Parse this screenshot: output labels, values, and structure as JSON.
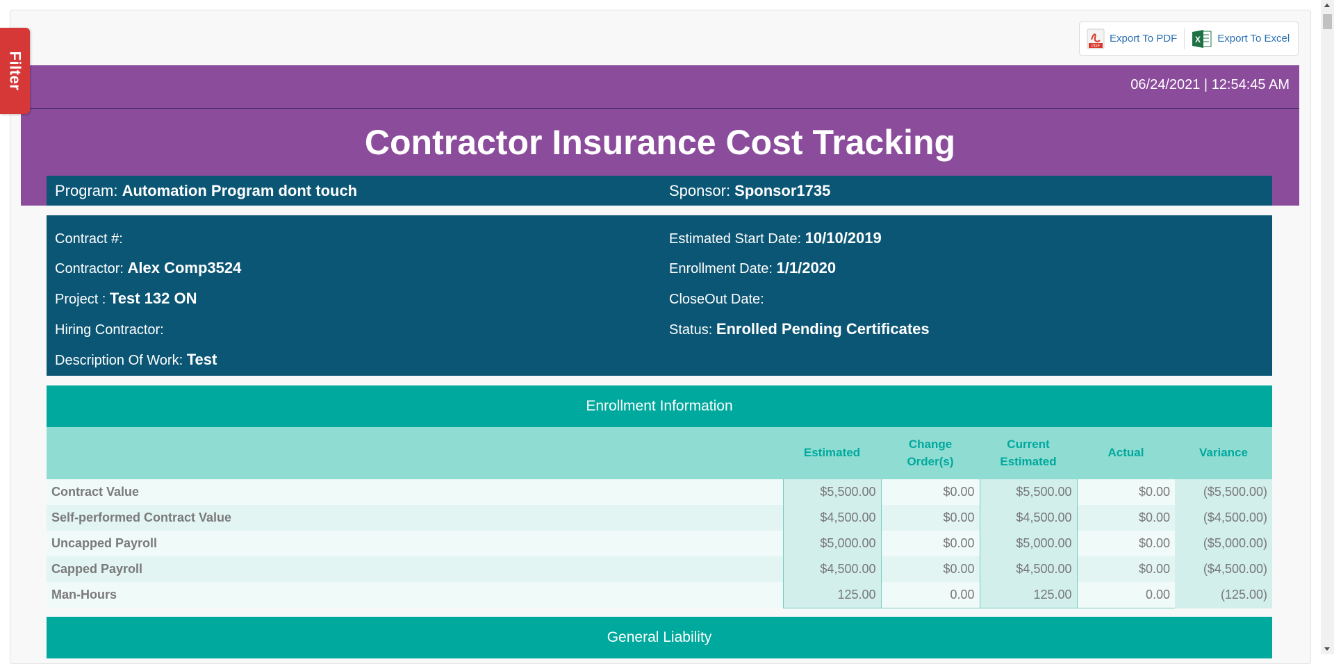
{
  "filter": {
    "label": "Filter"
  },
  "export": {
    "pdf_label": "Export To PDF",
    "excel_label": "Export To Excel"
  },
  "header": {
    "datetime": "06/24/2021 | 12:54:45 AM",
    "title": "Contractor Insurance Cost Tracking"
  },
  "program": {
    "program_label": "Program: ",
    "program_value": "Automation Program dont touch",
    "sponsor_label": "Sponsor: ",
    "sponsor_value": "Sponsor1735"
  },
  "details": {
    "contract_label": "Contract #:",
    "contract_value": "",
    "contractor_label": "Contractor: ",
    "contractor_value": "Alex Comp3524",
    "project_label": "Project : ",
    "project_value": "Test 132 ON",
    "hiring_label": "Hiring Contractor:",
    "hiring_value": "",
    "description_label": "Description Of Work: ",
    "description_value": "Test",
    "start_label": "Estimated Start Date: ",
    "start_value": "10/10/2019",
    "enrollment_label": "Enrollment Date: ",
    "enrollment_value": "1/1/2020",
    "closeout_label": "CloseOut Date:",
    "closeout_value": "",
    "status_label": "Status: ",
    "status_value": "Enrolled Pending Certificates"
  },
  "enrollment": {
    "title": "Enrollment Information",
    "columns": [
      "",
      "Estimated",
      "Change Order(s)",
      "Current Estimated",
      "Actual",
      "Variance"
    ],
    "rows": [
      [
        "Contract Value",
        "$5,500.00",
        "$0.00",
        "$5,500.00",
        "$0.00",
        "($5,500.00)"
      ],
      [
        "Self-performed Contract Value",
        "$4,500.00",
        "$0.00",
        "$4,500.00",
        "$0.00",
        "($4,500.00)"
      ],
      [
        "Uncapped Payroll",
        "$5,000.00",
        "$0.00",
        "$5,000.00",
        "$0.00",
        "($5,000.00)"
      ],
      [
        "Capped Payroll",
        "$4,500.00",
        "$0.00",
        "$4,500.00",
        "$0.00",
        "($4,500.00)"
      ],
      [
        "Man-Hours",
        "125.00",
        "0.00",
        "125.00",
        "0.00",
        "(125.00)"
      ]
    ]
  },
  "general_liability": {
    "title": "General Liability"
  },
  "colors": {
    "purple": "#8b4c9c",
    "navy": "#0b5675",
    "teal": "#00a99d",
    "filter_red": "#d63838"
  }
}
